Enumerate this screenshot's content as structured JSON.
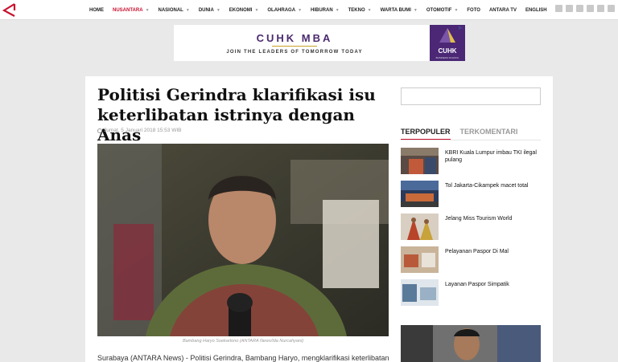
{
  "nav": {
    "items": [
      {
        "label": "HOME",
        "active": false,
        "dropdown": false
      },
      {
        "label": "NUSANTARA",
        "active": true,
        "dropdown": true
      },
      {
        "label": "NASIONAL",
        "active": false,
        "dropdown": true
      },
      {
        "label": "DUNIA",
        "active": false,
        "dropdown": true
      },
      {
        "label": "EKONOMI",
        "active": false,
        "dropdown": true
      },
      {
        "label": "OLAHRAGA",
        "active": false,
        "dropdown": true
      },
      {
        "label": "HIBURAN",
        "active": false,
        "dropdown": true
      },
      {
        "label": "TEKNO",
        "active": false,
        "dropdown": true
      },
      {
        "label": "WARTA BUMI",
        "active": false,
        "dropdown": true
      },
      {
        "label": "OTOMOTIF",
        "active": false,
        "dropdown": true
      },
      {
        "label": "FOTO",
        "active": false,
        "dropdown": false
      },
      {
        "label": "ANTARA TV",
        "active": false,
        "dropdown": false
      },
      {
        "label": "ENGLISH",
        "active": false,
        "dropdown": false
      }
    ],
    "social_icons": [
      "user-icon",
      "facebook-icon",
      "twitter-icon",
      "instagram-icon",
      "youtube-icon",
      "google-plus-icon"
    ]
  },
  "ad": {
    "title": "CUHK MBA",
    "subtitle": "JOIN THE LEADERS OF TOMORROW TODAY",
    "logo_text": "CUHK",
    "logo_sub": "BUSINESS SCHOOL"
  },
  "article": {
    "title": "Politisi Gerindra klarifikasi isu keterlibatan istrinya dengan Anas",
    "date": "Jumat, 5 Januari 2018 15:53 WIB",
    "caption": "Bambang Haryo Soekartono (ANTARA News/Ida Nurcahyani)",
    "lead": "Surabaya (ANTARA News) - Politisi Gerindra, Bambang Haryo, mengklarifikasi keterlibatan"
  },
  "sidebar": {
    "search_placeholder": "",
    "tabs": [
      {
        "label": "TERPOPULER",
        "active": true
      },
      {
        "label": "TERKOMENTARI",
        "active": false
      }
    ],
    "items": [
      {
        "title": "KBRI Kuala Lumpur imbau TKI ilegal pulang"
      },
      {
        "title": "Tol Jakarta-Cikampek macet total"
      },
      {
        "title": "Jelang Miss Tourism World"
      },
      {
        "title": "Pelayanan Paspor Di Mal"
      },
      {
        "title": "Layanan Paspor Simpatik"
      }
    ]
  },
  "colors": {
    "accent": "#c8102e",
    "ad_purple": "#4b2776"
  }
}
